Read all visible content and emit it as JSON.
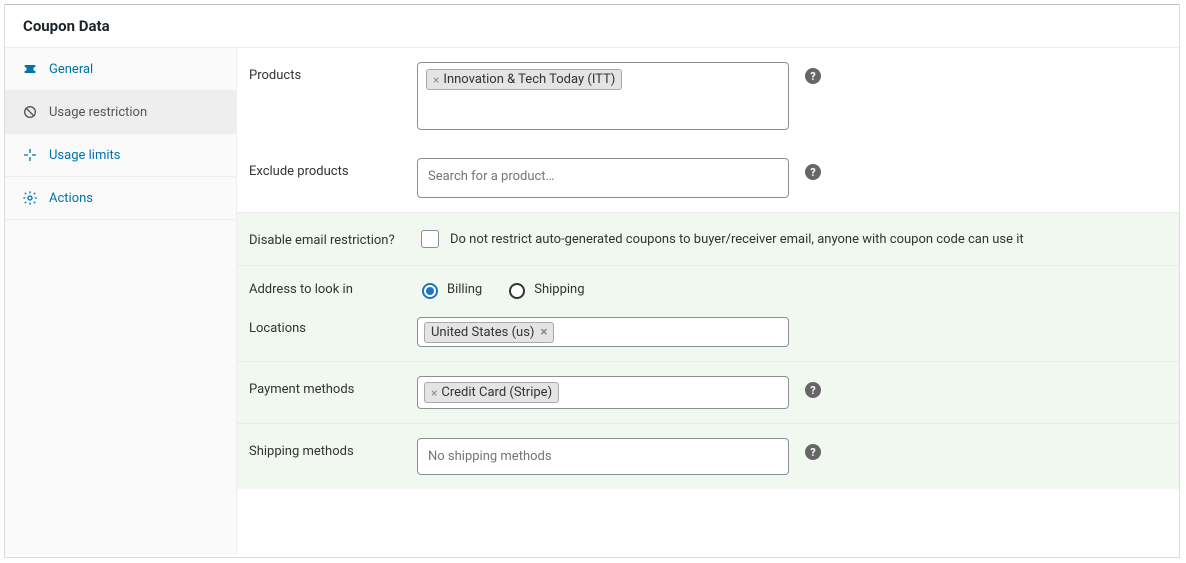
{
  "panel": {
    "title": "Coupon Data"
  },
  "sidebar": {
    "items": [
      {
        "label": "General"
      },
      {
        "label": "Usage restriction"
      },
      {
        "label": "Usage limits"
      },
      {
        "label": "Actions"
      }
    ]
  },
  "fields": {
    "products": {
      "label": "Products",
      "tags": [
        "Innovation & Tech Today (ITT)"
      ]
    },
    "exclude_products": {
      "label": "Exclude products",
      "placeholder": "Search for a product…"
    },
    "disable_email": {
      "label": "Disable email restriction?",
      "checkbox_label": "Do not restrict auto-generated coupons to buyer/receiver email, anyone with coupon code can use it",
      "checked": false
    },
    "address_look": {
      "label": "Address to look in",
      "options": {
        "billing": "Billing",
        "shipping": "Shipping"
      },
      "selected": "billing"
    },
    "locations": {
      "label": "Locations",
      "tags": [
        "United States (us)"
      ]
    },
    "payment_methods": {
      "label": "Payment methods",
      "tags": [
        "Credit Card (Stripe)"
      ]
    },
    "shipping_methods": {
      "label": "Shipping methods",
      "placeholder": "No shipping methods"
    }
  },
  "help_glyph": "?"
}
